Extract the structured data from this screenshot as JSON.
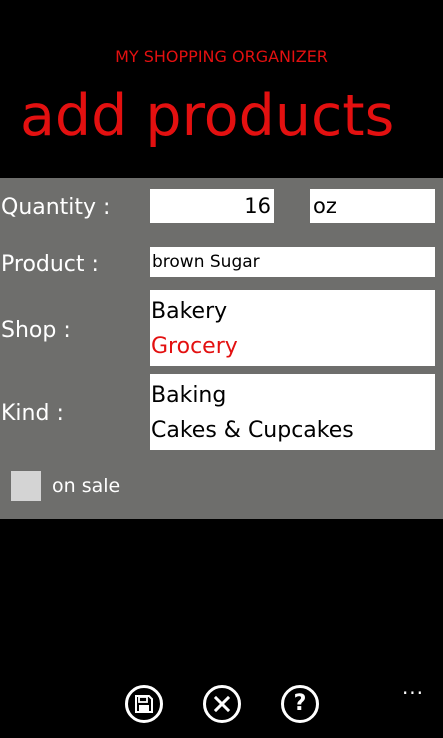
{
  "header": {
    "app_title": "MY SHOPPING ORGANIZER",
    "page_title": "add products"
  },
  "form": {
    "quantity": {
      "label": "Quantity :",
      "value": "16",
      "unit": "oz"
    },
    "product": {
      "label": "Product :",
      "value": "brown Sugar"
    },
    "shop": {
      "label": "Shop :",
      "options": [
        "Bakery",
        "Grocery"
      ],
      "selected": "Grocery"
    },
    "kind": {
      "label": "Kind :",
      "options": [
        "Baking",
        "Cakes & Cupcakes"
      ]
    },
    "on_sale": {
      "label": "on sale",
      "checked": false
    }
  },
  "app_bar": {
    "buttons": [
      {
        "name": "save",
        "icon": "floppy-disk-icon"
      },
      {
        "name": "cancel",
        "icon": "close-icon"
      },
      {
        "name": "help",
        "icon": "question-icon",
        "glyph": "?"
      }
    ],
    "more": "..."
  },
  "colors": {
    "accent": "#e31010",
    "panel": "#6e6e6c",
    "background": "#000000"
  }
}
